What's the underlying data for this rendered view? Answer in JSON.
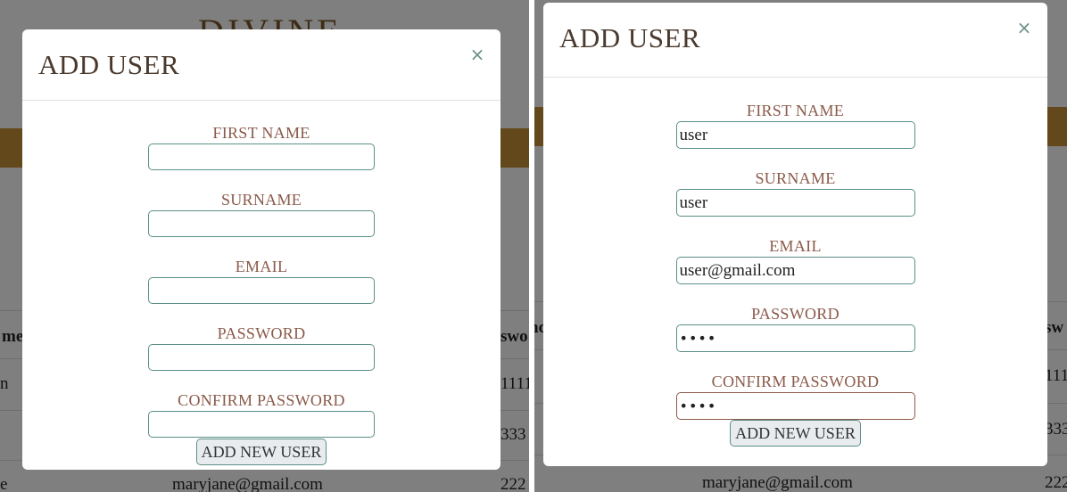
{
  "background": {
    "logo_text": "DIVINE",
    "left_cells": {
      "col_a_header": "me",
      "col_b_header": "swo",
      "row1_a": "n",
      "row1_b": "1111",
      "row2_b": "333",
      "row3_a": "e",
      "row3_b": "222",
      "email_row3": "maryjane@gmail.com"
    },
    "right_cells": {
      "col_a_header": "nc",
      "col_b_header": "sw",
      "row1_b": "111",
      "row2_b": "333",
      "row3_b": "222",
      "email_row3": "maryjane@gmail.com"
    }
  },
  "modal_left": {
    "title": "ADD USER",
    "close_glyph": "×",
    "fields": [
      {
        "label": "FIRST NAME",
        "value": ""
      },
      {
        "label": "SURNAME",
        "value": ""
      },
      {
        "label": "EMAIL",
        "value": ""
      },
      {
        "label": "PASSWORD",
        "value": ""
      },
      {
        "label": "CONFIRM PASSWORD",
        "value": ""
      }
    ],
    "submit_label": "ADD NEW USER"
  },
  "modal_right": {
    "title": "ADD USER",
    "close_glyph": "×",
    "fields": [
      {
        "label": "FIRST NAME",
        "value": "user"
      },
      {
        "label": "SURNAME",
        "value": "user"
      },
      {
        "label": "EMAIL",
        "value": "user@gmail.com"
      },
      {
        "label": "PASSWORD",
        "value": "••••"
      },
      {
        "label": "CONFIRM PASSWORD",
        "value": "••••"
      }
    ],
    "submit_label": "ADD NEW USER"
  },
  "colors": {
    "accent_band": "#c49035",
    "input_border": "#5b8f88",
    "label_text": "#8a5a4a",
    "backdrop": "rgba(0,0,0,0.5)"
  },
  "icons": {
    "close": "close-icon"
  }
}
